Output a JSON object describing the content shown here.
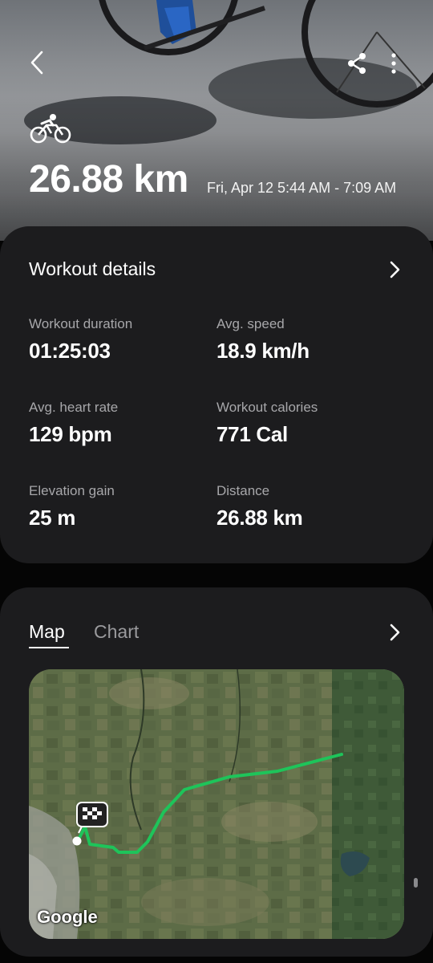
{
  "header": {
    "back_icon": "back-arrow-icon",
    "share_icon": "share-icon",
    "more_icon": "more-vertical-icon",
    "activity_icon": "cycling-icon",
    "distance": "26.88 km",
    "date_range": "Fri, Apr 12 5:44 AM - 7:09 AM"
  },
  "details": {
    "title": "Workout details",
    "metrics": [
      {
        "label": "Workout duration",
        "value": "01:25:03"
      },
      {
        "label": "Avg. speed",
        "value": "18.9 km/h"
      },
      {
        "label": "Avg. heart rate",
        "value": "129 bpm"
      },
      {
        "label": "Workout calories",
        "value": "771 Cal"
      },
      {
        "label": "Elevation gain",
        "value": "25 m"
      },
      {
        "label": "Distance",
        "value": "26.88 km"
      }
    ]
  },
  "map_section": {
    "tabs": [
      "Map",
      "Chart"
    ],
    "selected_tab": "Map",
    "map_provider": "Google",
    "route_color": "#1ec45a"
  },
  "colors": {
    "card_bg": "#1c1c1e",
    "label_gray": "#a7a7aa",
    "route_green": "#1ec45a"
  }
}
